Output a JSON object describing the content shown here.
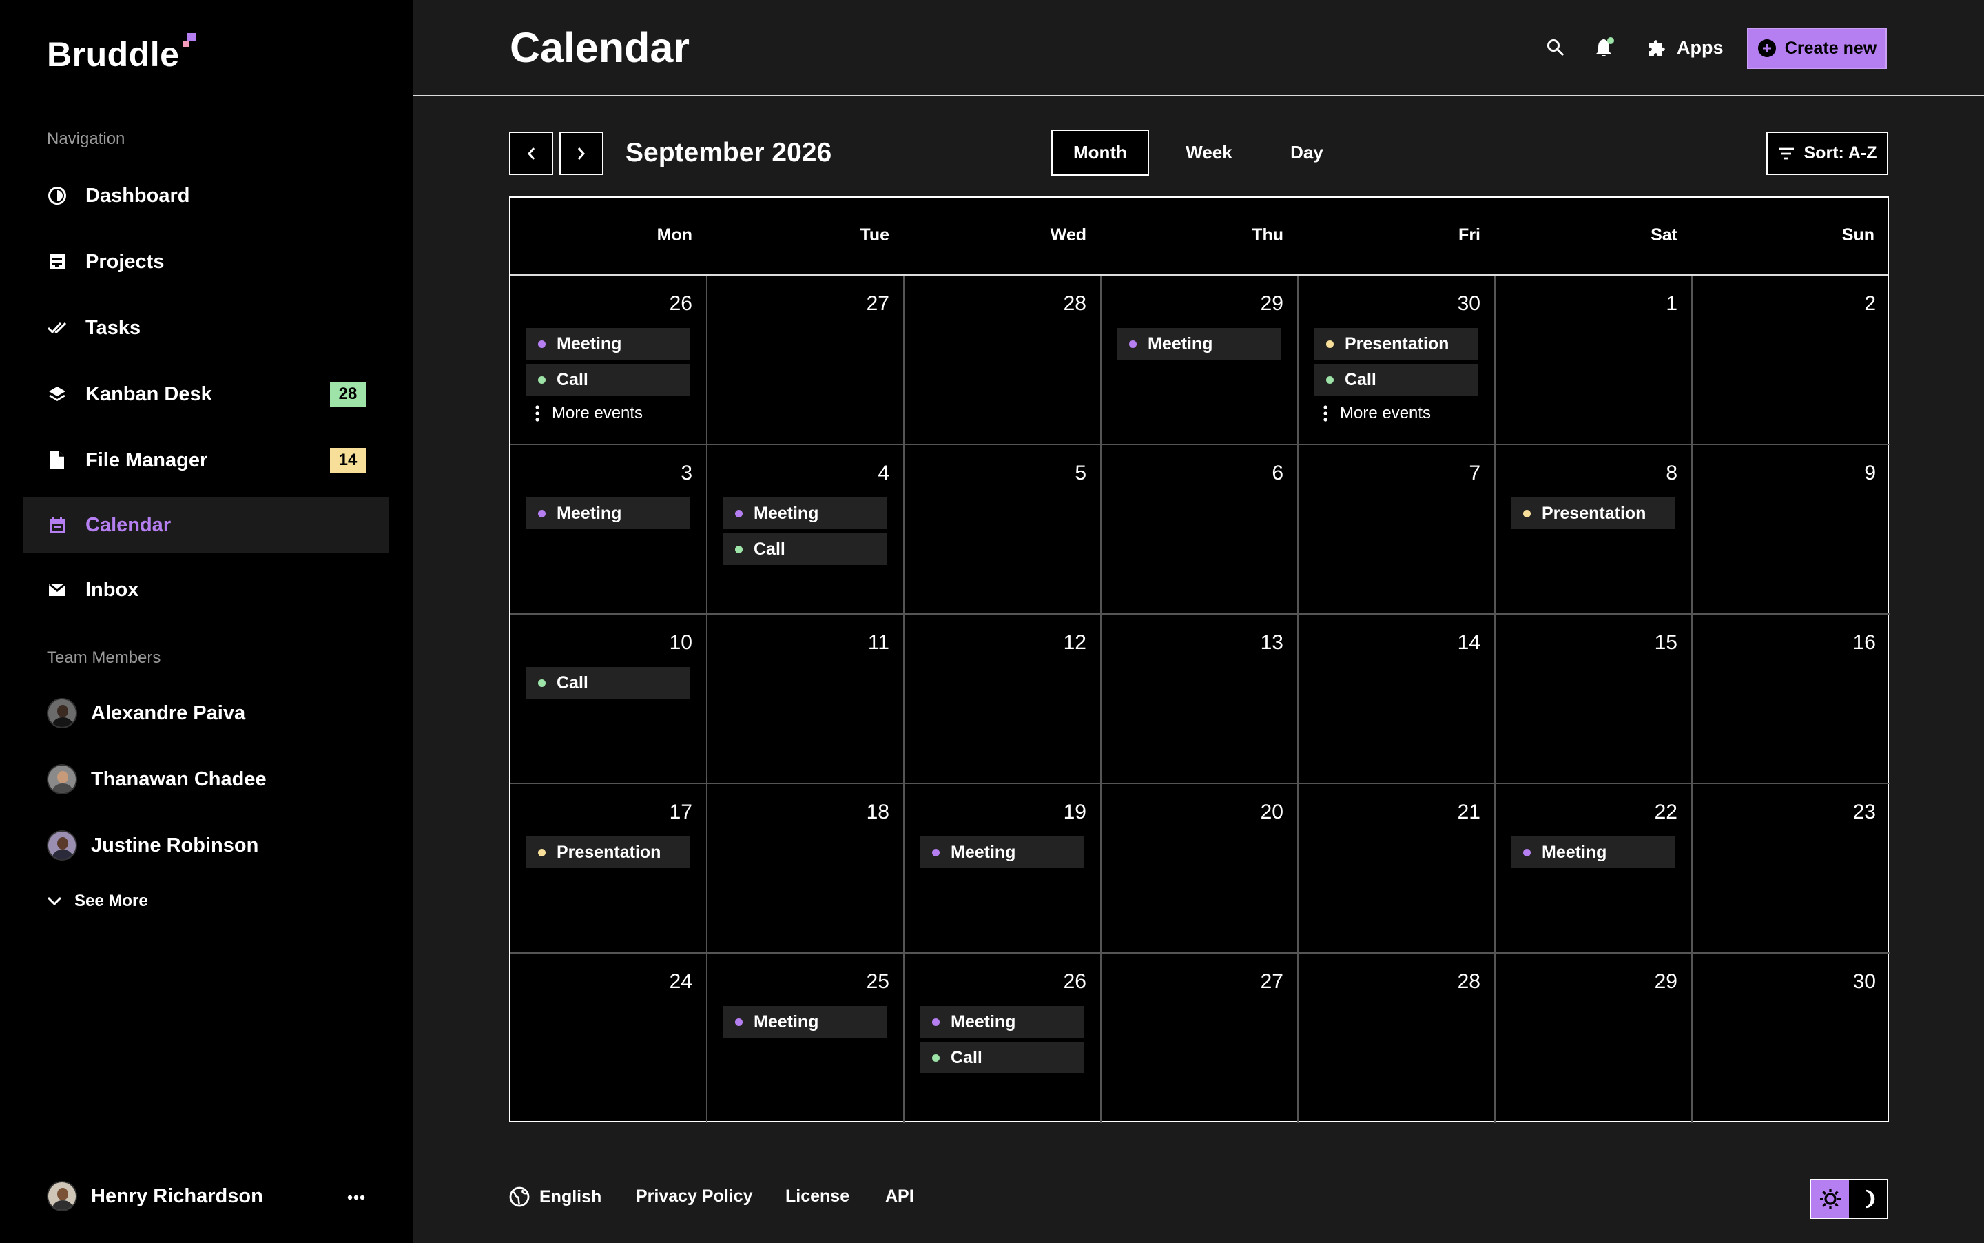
{
  "brand": {
    "name": "Bruddle"
  },
  "sidebar": {
    "nav_title": "Navigation",
    "items": [
      {
        "label": "Dashboard",
        "icon": "dashboard-icon"
      },
      {
        "label": "Projects",
        "icon": "projects-icon"
      },
      {
        "label": "Tasks",
        "icon": "tasks-icon"
      },
      {
        "label": "Kanban Desk",
        "icon": "layers-icon",
        "badge": "28",
        "badge_color": "#9ee3a8"
      },
      {
        "label": "File Manager",
        "icon": "file-icon",
        "badge": "14",
        "badge_color": "#f7df9a"
      },
      {
        "label": "Calendar",
        "icon": "calendar-icon",
        "active": true
      },
      {
        "label": "Inbox",
        "icon": "mail-icon"
      }
    ],
    "team_title": "Team Members",
    "members": [
      {
        "name": "Alexandre Paiva"
      },
      {
        "name": "Thanawan Chadee"
      },
      {
        "name": "Justine Robinson"
      }
    ],
    "see_more": "See More",
    "profile": {
      "name": "Henry Richardson"
    }
  },
  "header": {
    "title": "Calendar",
    "apps_label": "Apps",
    "create_label": "Create new"
  },
  "toolbar": {
    "month_label": "September 2026",
    "views": [
      "Month",
      "Week",
      "Day"
    ],
    "active_view": "Month",
    "sort_label": "Sort: A-Z"
  },
  "calendar": {
    "weekdays": [
      "Mon",
      "Tue",
      "Wed",
      "Thu",
      "Fri",
      "Sat",
      "Sun"
    ],
    "event_colors": {
      "Meeting": "#b67ff1",
      "Call": "#9ee3a8",
      "Presentation": "#f7df9a"
    },
    "more_events_label": "More events",
    "weeks": [
      [
        {
          "day": "26",
          "events": [
            "Meeting",
            "Call"
          ],
          "more": true
        },
        {
          "day": "27",
          "events": []
        },
        {
          "day": "28",
          "events": []
        },
        {
          "day": "29",
          "events": [
            "Meeting"
          ]
        },
        {
          "day": "30",
          "events": [
            "Presentation",
            "Call"
          ],
          "more": true
        },
        {
          "day": "1",
          "events": []
        },
        {
          "day": "2",
          "events": []
        }
      ],
      [
        {
          "day": "3",
          "events": [
            "Meeting"
          ]
        },
        {
          "day": "4",
          "events": [
            "Meeting",
            "Call"
          ]
        },
        {
          "day": "5",
          "events": []
        },
        {
          "day": "6",
          "events": []
        },
        {
          "day": "7",
          "events": []
        },
        {
          "day": "8",
          "events": [
            "Presentation"
          ]
        },
        {
          "day": "9",
          "events": []
        }
      ],
      [
        {
          "day": "10",
          "events": [
            "Call"
          ]
        },
        {
          "day": "11",
          "events": []
        },
        {
          "day": "12",
          "events": []
        },
        {
          "day": "13",
          "events": []
        },
        {
          "day": "14",
          "events": []
        },
        {
          "day": "15",
          "events": []
        },
        {
          "day": "16",
          "events": []
        }
      ],
      [
        {
          "day": "17",
          "events": [
            "Presentation"
          ]
        },
        {
          "day": "18",
          "events": []
        },
        {
          "day": "19",
          "events": [
            "Meeting"
          ]
        },
        {
          "day": "20",
          "events": []
        },
        {
          "day": "21",
          "events": []
        },
        {
          "day": "22",
          "events": [
            "Meeting"
          ]
        },
        {
          "day": "23",
          "events": []
        }
      ],
      [
        {
          "day": "24",
          "events": []
        },
        {
          "day": "25",
          "events": [
            "Meeting"
          ]
        },
        {
          "day": "26",
          "events": [
            "Meeting",
            "Call"
          ]
        },
        {
          "day": "27",
          "events": []
        },
        {
          "day": "28",
          "events": []
        },
        {
          "day": "29",
          "events": []
        },
        {
          "day": "30",
          "events": []
        }
      ]
    ]
  },
  "footer": {
    "language": "English",
    "links": [
      "Privacy Policy",
      "License",
      "API"
    ]
  },
  "colors": {
    "accent": "#b67ff1",
    "background": "#1b1b1b",
    "sidebar": "#000000"
  }
}
